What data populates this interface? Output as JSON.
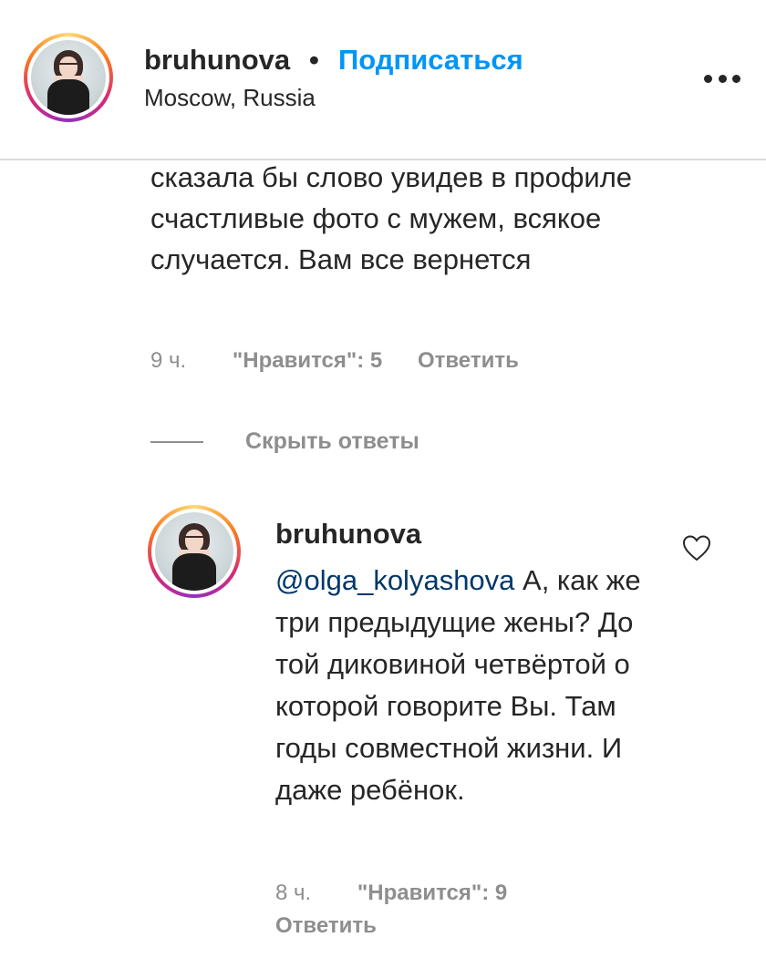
{
  "header": {
    "username": "bruhunova",
    "separator": "•",
    "follow_label": "Подписаться",
    "location": "Moscow, Russia",
    "more_icon": "more-horizontal-icon"
  },
  "comment": {
    "text": "сказала бы слово увидев в профиле счастливые фото с мужем, всякое случается. Вам все вернется",
    "time": "9 ч.",
    "likes": "\"Нравится\": 5",
    "reply_label": "Ответить"
  },
  "replies_toggle": {
    "label": "Скрыть ответы"
  },
  "reply": {
    "username": "bruhunova",
    "mention": "@olga_kolyashova",
    "text": " А, как же три предыдущие жены? До той диковиной четвёртой о которой говорите Вы. Там годы совместной жизни. И даже ребёнок.",
    "time": "8 ч.",
    "likes": "\"Нравится\": 9",
    "reply_label": "Ответить",
    "like_icon": "heart-icon"
  },
  "colors": {
    "link": "#0095f6",
    "mention": "#00376b",
    "text": "#262626",
    "muted": "#8e8e8e"
  }
}
